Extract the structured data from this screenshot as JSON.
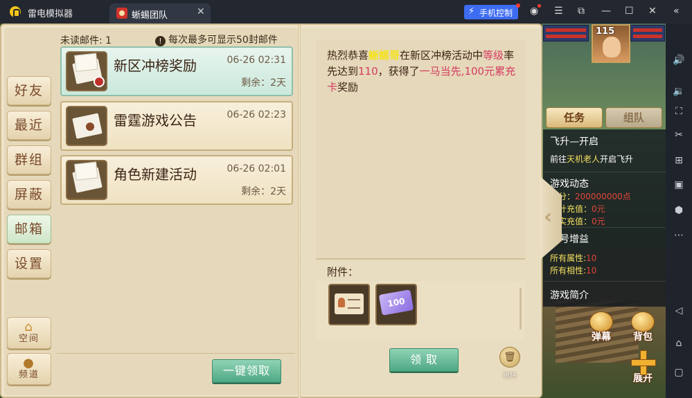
{
  "titlebar": {
    "app_title": "雷电模拟器",
    "tab_label": "蜥蜴团队",
    "tab_close": "✕",
    "phone_control": "手机控制",
    "icons": [
      "user-icon",
      "menu-icon",
      "restore-window-icon",
      "minimize-icon",
      "maximize-icon",
      "close-icon",
      "collapse-sidebar-icon"
    ]
  },
  "side_toolbar": {
    "icons": [
      "volume-up-icon",
      "volume-down-icon",
      "resize-icon",
      "scissors-icon",
      "add-icon",
      "apk-icon",
      "settings-hex-icon",
      "more-icon",
      "back-icon",
      "home-icon",
      "recent-apps-icon"
    ]
  },
  "mail": {
    "unread_label": "未读邮件: 1",
    "max_note": "每次最多可显示50封邮件",
    "nav": {
      "friends": "好友",
      "recent": "最近",
      "groups": "群组",
      "blocked": "屏蔽",
      "mailbox": "邮箱",
      "settings": "设置",
      "space": "空间",
      "channel": "频道"
    },
    "items": [
      {
        "title": "新区冲榜奖励",
        "time": "06-26 02:31",
        "remain": "剩余：2天"
      },
      {
        "title": "雷霆游戏公告",
        "time": "06-26 02:23",
        "remain": ""
      },
      {
        "title": "角色新建活动",
        "time": "06-26 02:01",
        "remain": "剩余：2天"
      }
    ],
    "claim_all": "一键领取",
    "body": {
      "p1": "热烈恭喜",
      "name": "蜥蜴哥",
      "p2": "在新区冲榜活动中",
      "hl1": "等级",
      "p3": "率先达到",
      "hl2": "110",
      "p4": "，获得了",
      "hl3": "一马当先,100元累充卡",
      "p5": "奖励"
    },
    "attachment_label": "附件：",
    "attachments": [
      {
        "name": "card",
        "text": ""
      },
      {
        "name": "coupon",
        "text": "100"
      }
    ],
    "claim": "领 取",
    "delete": "删除",
    "delete_icon": "trash-icon"
  },
  "hud": {
    "level": "115",
    "task": "任务",
    "team": "组队",
    "ascend_title": "飞升—开启",
    "ascend_desc_prefix": "前往",
    "ascend_desc_name": "天机老人",
    "ascend_desc_suffix": "开启飞升",
    "dynamics_title": "游戏动态",
    "points_label": "积分：",
    "points_value": "200000000点",
    "acc_recharge_label": "累计充值：",
    "acc_recharge_value": "0元",
    "real_recharge_label": "真实充值：",
    "real_recharge_value": "0元",
    "bonus_title": "账号增益",
    "attr_label": "所有属性:",
    "attr_value": "10",
    "phase_label": "所有相性:",
    "phase_value": "10",
    "intro_title": "游戏简介",
    "barrage": "弹幕",
    "bag": "背包",
    "expand": "展开"
  }
}
